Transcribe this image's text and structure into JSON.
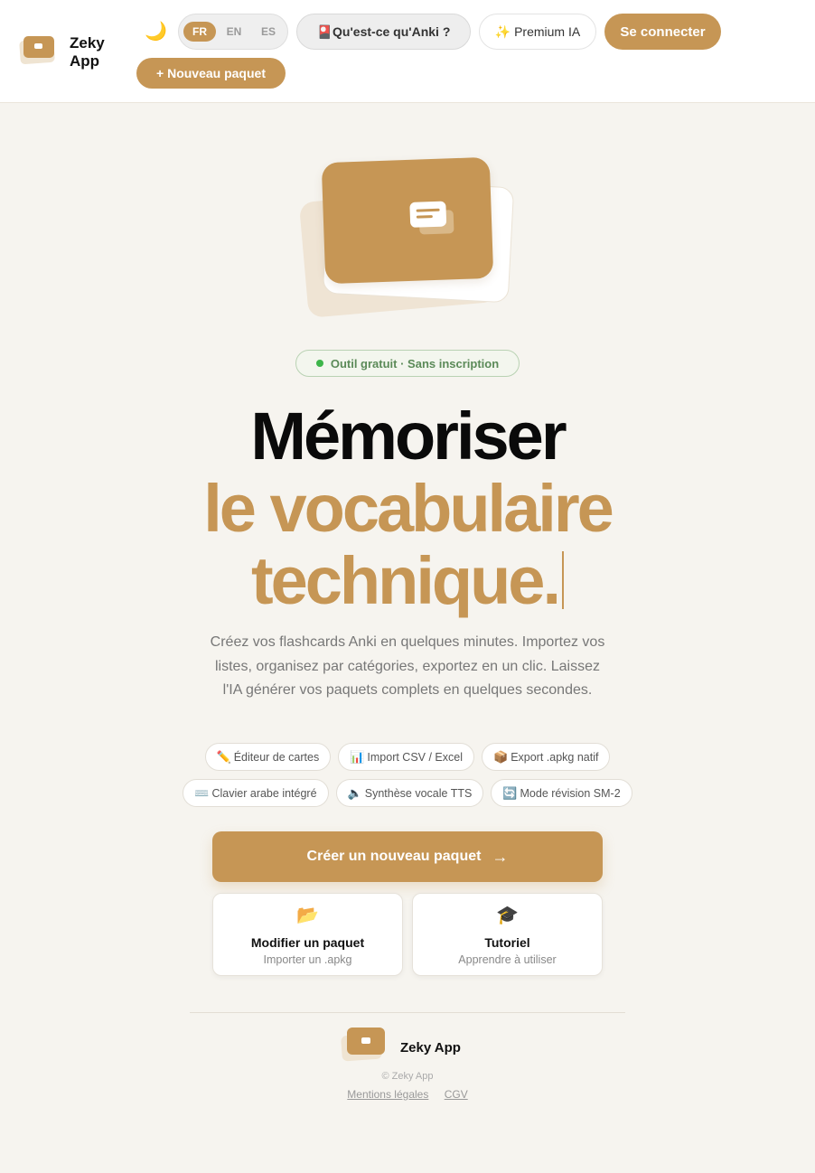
{
  "header": {
    "brand": "Zeky App",
    "moon_icon": "🌙",
    "languages": [
      "FR",
      "EN",
      "ES"
    ],
    "active_language": "FR",
    "anki_button": "🎴Qu'est-ce qu'Anki ?",
    "premium_button": "✨ Premium IA",
    "login_button": "Se connecter",
    "new_deck_button": "+ Nouveau paquet"
  },
  "hero": {
    "badge": "Outil gratuit · Sans inscription",
    "title_line1": "Mémoriser",
    "title_line2": "le vocabulaire",
    "title_line3": "technique.",
    "subtitle": "Créez vos flashcards Anki en quelques minutes. Importez vos listes, organisez par catégories, exportez en un clic. Laissez l'IA générer vos paquets complets en quelques secondes."
  },
  "features": [
    {
      "icon": "✏️",
      "label": "Éditeur de cartes"
    },
    {
      "icon": "📊",
      "label": "Import CSV / Excel"
    },
    {
      "icon": "📦",
      "label": "Export .apkg natif"
    },
    {
      "icon": "⌨️",
      "label": "Clavier arabe intégré"
    },
    {
      "icon": "🔈",
      "label": "Synthèse vocale TTS"
    },
    {
      "icon": "🔄",
      "label": "Mode révision SM-2"
    }
  ],
  "cta": {
    "label": "Créer un nouveau paquet",
    "arrow": "→"
  },
  "tiles": [
    {
      "icon": "📂",
      "title": "Modifier un paquet",
      "subtitle": "Importer un .apkg"
    },
    {
      "icon": "🎓",
      "title": "Tutoriel",
      "subtitle": "Apprendre à utiliser"
    }
  ],
  "footer": {
    "brand": "Zeky App",
    "copyright": "© Zeky App",
    "links": [
      "Mentions légales",
      "CGV"
    ]
  },
  "colors": {
    "accent": "#c69655",
    "background": "#f6f4ef",
    "badge_green": "#3db54a"
  }
}
